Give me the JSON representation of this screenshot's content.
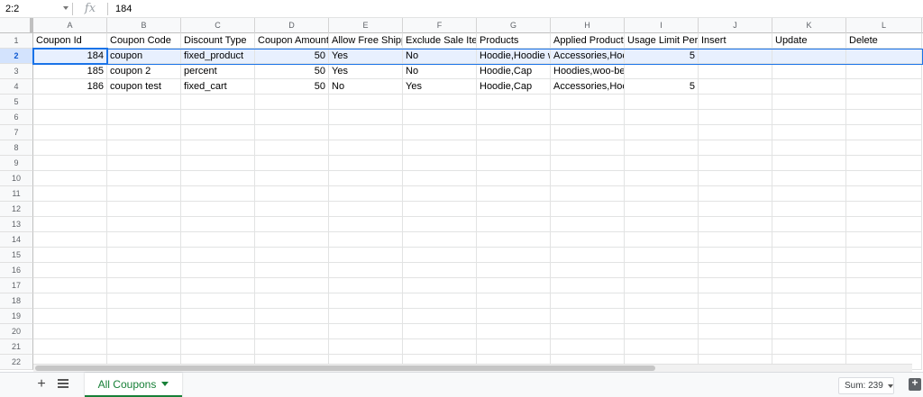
{
  "formula_bar": {
    "name_box": "2:2",
    "fx": "fx",
    "value": "184"
  },
  "columns": [
    "A",
    "B",
    "C",
    "D",
    "E",
    "F",
    "G",
    "H",
    "I",
    "J",
    "K",
    "L"
  ],
  "row_numbers": [
    "1",
    "2",
    "3",
    "4",
    "5",
    "6",
    "7",
    "8",
    "9",
    "10",
    "11",
    "12",
    "13",
    "14",
    "15",
    "16",
    "17",
    "18",
    "19",
    "20",
    "21",
    "22"
  ],
  "header_row": [
    "Coupon Id",
    "Coupon Code",
    "Discount Type",
    "Coupon Amount",
    "Allow Free Shipp",
    "Exclude Sale Iter",
    "Products",
    "Applied Product",
    "Usage Limit Per",
    "Insert",
    "Update",
    "Delete"
  ],
  "rows": [
    [
      "184",
      "coupon",
      "fixed_product",
      "50",
      "Yes",
      "No",
      "Hoodie,Hoodie w",
      "Accessories,Hoc",
      "5",
      "",
      "",
      ""
    ],
    [
      "185",
      "coupon 2",
      "percent",
      "50",
      "Yes",
      "No",
      "Hoodie,Cap",
      "Hoodies,woo-beanie",
      "",
      "",
      "",
      ""
    ],
    [
      "186",
      "coupon test",
      "fixed_cart",
      "50",
      "No",
      "Yes",
      "Hoodie,Cap",
      "Accessories,Hoc",
      "5",
      "",
      "",
      ""
    ]
  ],
  "numeric_columns": [
    0,
    3,
    8
  ],
  "sheet_tab": {
    "label": "All Coupons"
  },
  "sum": "Sum: 239",
  "colors": {
    "accent": "#1a73e8",
    "tab_green": "#188038"
  }
}
